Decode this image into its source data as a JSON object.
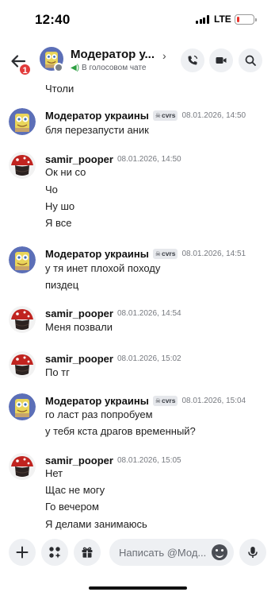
{
  "status_bar": {
    "time": "12:40",
    "network": "LTE",
    "battery_level": 0.15,
    "battery_color": "#e8352e"
  },
  "header": {
    "back_icon": "arrow-left-icon",
    "unread_count": "1",
    "title": "Модератор у...",
    "subtitle": "В голосовом чате",
    "subtitle_icon": "speaker-icon",
    "actions": [
      {
        "name": "call-button",
        "icon": "phone-icon"
      },
      {
        "name": "video-button",
        "icon": "video-camera-icon"
      },
      {
        "name": "search-button",
        "icon": "search-icon"
      }
    ]
  },
  "partial_message": "Чтоли",
  "messages": [
    {
      "author": "Модератор украины",
      "tag": "cvrs",
      "timestamp": "08.01.2026, 14:50",
      "avatar": "sponge-avatar",
      "lines": [
        "бля перезапусти аник"
      ]
    },
    {
      "author": "samir_pooper",
      "timestamp": "08.01.2026, 14:50",
      "avatar": "mushroom-avatar",
      "lines": [
        "Ок ни со",
        "Чо",
        "Ну шо",
        "Я все"
      ]
    },
    {
      "author": "Модератор украины",
      "tag": "cvrs",
      "timestamp": "08.01.2026, 14:51",
      "avatar": "sponge-avatar",
      "lines": [
        "у тя инет плохой походу",
        "пиздец"
      ]
    },
    {
      "author": "samir_pooper",
      "timestamp": "08.01.2026, 14:54",
      "avatar": "mushroom-avatar",
      "lines": [
        "Меня позвали"
      ]
    },
    {
      "author": "samir_pooper",
      "timestamp": "08.01.2026, 15:02",
      "avatar": "mushroom-avatar",
      "lines": [
        "По тг"
      ]
    },
    {
      "author": "Модератор украины",
      "tag": "cvrs",
      "timestamp": "08.01.2026, 15:04",
      "avatar": "sponge-avatar",
      "lines": [
        "го ласт раз попробуем",
        "у тебя кста драгов временный?"
      ]
    },
    {
      "author": "samir_pooper",
      "timestamp": "08.01.2026, 15:05",
      "avatar": "mushroom-avatar",
      "lines": [
        "Нет",
        "Щас не могу",
        "Го вечером",
        "Я делами занимаюсь"
      ]
    }
  ],
  "composer": {
    "placeholder": "Написать @Мод...",
    "buttons": [
      {
        "name": "add-attachment-button",
        "icon": "plus-icon"
      },
      {
        "name": "apps-button",
        "icon": "apps-sparkle-icon"
      },
      {
        "name": "gift-button",
        "icon": "gift-icon"
      }
    ],
    "emoji_icon": "emoji-icon",
    "mic_icon": "microphone-icon"
  }
}
